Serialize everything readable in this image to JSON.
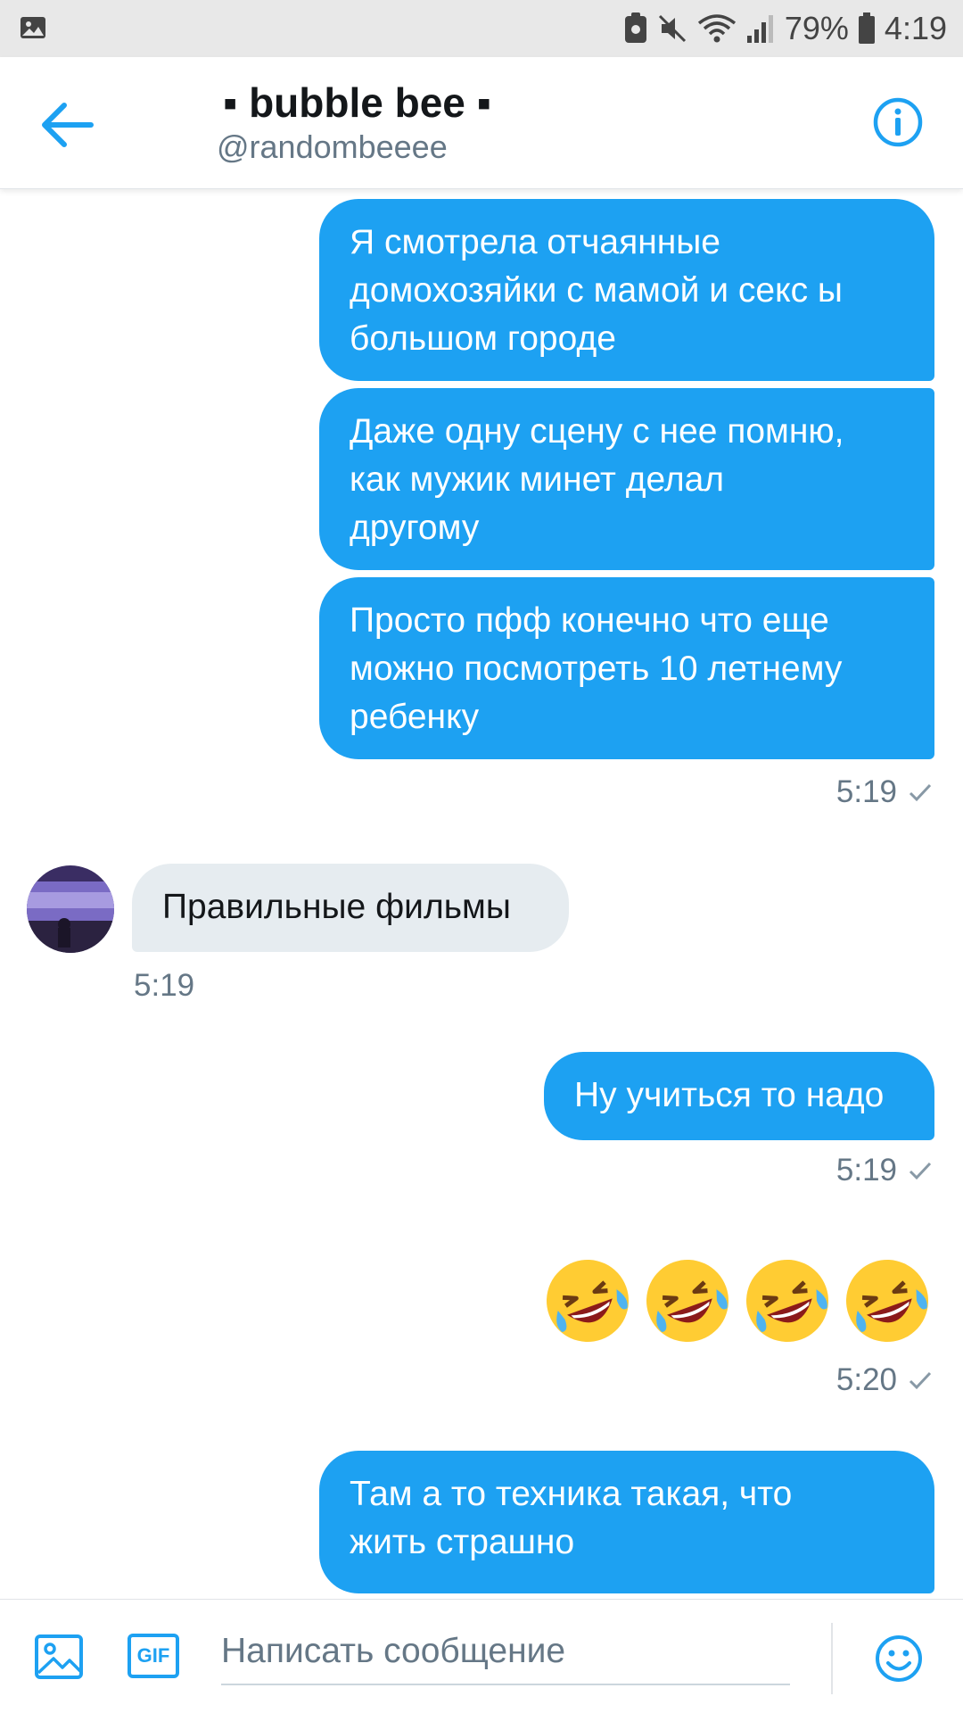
{
  "status_bar": {
    "battery": "79%",
    "time": "4:19"
  },
  "header": {
    "name": "▪ bubble bee ▪",
    "handle": "@randombeeee"
  },
  "messages": [
    {
      "direction": "out",
      "text": "Я смотрела отчаянные\nдомохозяйки с мамой и секс ы\nбольшом городе"
    },
    {
      "direction": "out",
      "text": "Даже одну сцену с нее помню,\nкак мужик минет делал\nдругому"
    },
    {
      "direction": "out",
      "text": "Просто пфф конечно что еще\nможно посмотреть 10 летнему\nребенку",
      "time": "5:19"
    },
    {
      "direction": "in",
      "text": "Правильные фильмы",
      "time": "5:19"
    },
    {
      "direction": "out",
      "text": "Ну учиться то надо",
      "time": "5:19"
    },
    {
      "direction": "out",
      "emoji": "rolling-on-floor-laughing",
      "count": 4,
      "time": "5:20"
    },
    {
      "direction": "out",
      "text": "Там а то техника такая, что\nжить страшно"
    }
  ],
  "compose": {
    "placeholder": "Написать сообщение",
    "gif_label": "GIF"
  },
  "colors": {
    "accent": "#1da1f2",
    "incoming_bubble": "#e6ecf0",
    "secondary_text": "#657786"
  }
}
